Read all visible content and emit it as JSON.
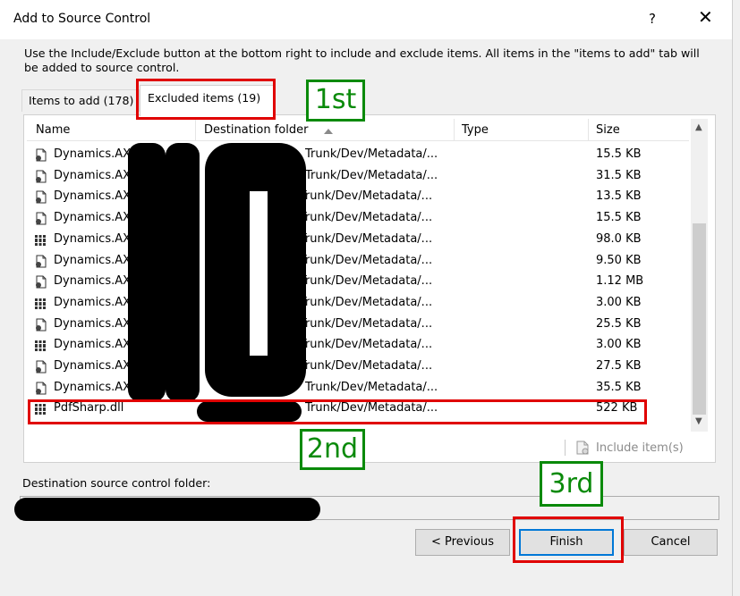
{
  "window": {
    "title": "Add to Source Control",
    "help_glyph": "?",
    "close_glyph": "✕"
  },
  "description": "Use the Include/Exclude button at the bottom right to include and exclude items. All items in the \"items to add\" tab will be added to source control.",
  "tabs": [
    {
      "label": "Items to add (178)",
      "active": false
    },
    {
      "label": "Excluded items (19)",
      "active": true
    }
  ],
  "columns": {
    "name": "Name",
    "destination": "Destination folder",
    "type": "Type",
    "size": "Size"
  },
  "rows": [
    {
      "icon": "document-icon",
      "name": "Dynamics.AX",
      "dest": "Trunk/Dev/Metadata/...",
      "type": "",
      "size": "15.5 KB"
    },
    {
      "icon": "document-icon",
      "name": "Dynamics.AX",
      "dest": "Trunk/Dev/Metadata/...",
      "type": "",
      "size": "31.5 KB"
    },
    {
      "icon": "document-icon",
      "name": "Dynamics.AX",
      "dest": "Up Trunk/Dev/Metadata/...",
      "type": "",
      "size": "13.5 KB"
    },
    {
      "icon": "document-icon",
      "name": "Dynamics.AX",
      "dest": "Up Trunk/Dev/Metadata/...",
      "type": "",
      "size": "15.5 KB"
    },
    {
      "icon": "library-icon",
      "name": "Dynamics.AX",
      "dest": "Up Trunk/Dev/Metadata/...",
      "type": "",
      "size": "98.0 KB"
    },
    {
      "icon": "document-icon",
      "name": "Dynamics.AX",
      "dest": "Up Trunk/Dev/Metadata/...",
      "type": "",
      "size": "9.50 KB"
    },
    {
      "icon": "document-icon",
      "name": "Dynamics.AX",
      "dest": "Up Trunk/Dev/Metadata/...",
      "type": "",
      "size": "1.12 MB"
    },
    {
      "icon": "library-icon",
      "name": "Dynamics.AX",
      "dest": "Up Trunk/Dev/Metadata/...",
      "type": "",
      "size": "3.00 KB"
    },
    {
      "icon": "document-icon",
      "name": "Dynamics.AX",
      "dest": "Up Trunk/Dev/Metadata/...",
      "type": "",
      "size": "25.5 KB"
    },
    {
      "icon": "library-icon",
      "name": "Dynamics.AX",
      "dest": "Up Trunk/Dev/Metadata/...",
      "type": "",
      "size": "3.00 KB"
    },
    {
      "icon": "document-icon",
      "name": "Dynamics.AX",
      "dest": "Up Trunk/Dev/Metadata/...",
      "type": "",
      "size": "27.5 KB"
    },
    {
      "icon": "document-icon",
      "name": "Dynamics.AX",
      "dest": "Trunk/Dev/Metadata/...",
      "type": "",
      "size": "35.5 KB"
    },
    {
      "icon": "library-icon",
      "name": "PdfSharp.dll",
      "dest": "Trunk/Dev/Metadata/...",
      "type": "",
      "size": "522 KB"
    }
  ],
  "include_button": "Include item(s)",
  "destination_label": "Destination source control folder:",
  "buttons": {
    "previous": "< Previous",
    "finish": "Finish",
    "cancel": "Cancel"
  },
  "annotations": [
    "1st",
    "2nd",
    "3rd"
  ],
  "colors": {
    "red_highlight": "#e00000",
    "green_label": "#0a8a0a",
    "finish_focus": "#0078d7"
  }
}
